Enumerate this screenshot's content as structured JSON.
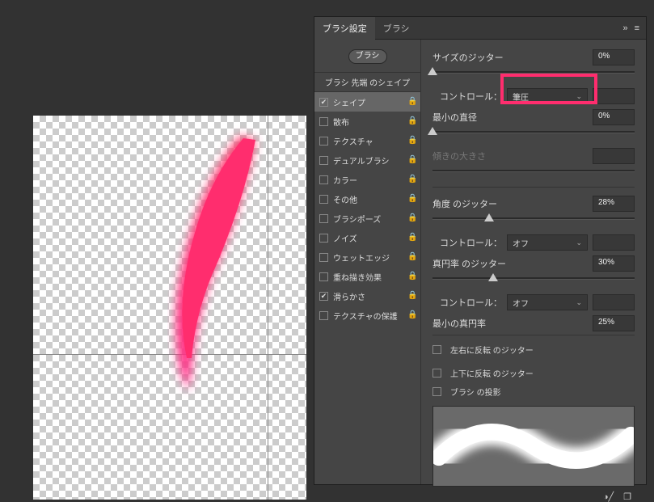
{
  "tabs": {
    "settings": "ブラシ設定",
    "brushes": "ブラシ"
  },
  "presetButton": "ブラシ",
  "tipShapeLabel": "ブラシ 先端 のシェイプ",
  "options": [
    {
      "label": "シェイプ",
      "checked": true,
      "selected": true
    },
    {
      "label": "散布",
      "checked": false
    },
    {
      "label": "テクスチャ",
      "checked": false
    },
    {
      "label": "デュアルブラシ",
      "checked": false
    },
    {
      "label": "カラー",
      "checked": false
    },
    {
      "label": "その他",
      "checked": false
    },
    {
      "label": "ブラシポーズ",
      "checked": false
    },
    {
      "label": "ノイズ",
      "checked": false
    },
    {
      "label": "ウェットエッジ",
      "checked": false
    },
    {
      "label": "重ね描き効果",
      "checked": false
    },
    {
      "label": "滑らかさ",
      "checked": true
    },
    {
      "label": "テクスチャの保護",
      "checked": false
    }
  ],
  "sizeJitter": {
    "label": "サイズのジッター",
    "value": "0%"
  },
  "control1": {
    "label": "コントロール：",
    "value": "筆圧"
  },
  "minDiam": {
    "label": "最小の直径",
    "value": "0%"
  },
  "tiltScale": {
    "label": "傾きの大きさ"
  },
  "angleJitter": {
    "label": "角度 のジッター",
    "value": "28%"
  },
  "control2": {
    "label": "コントロール：",
    "value": "オフ"
  },
  "roundJitter": {
    "label": "真円率 のジッター",
    "value": "30%"
  },
  "control3": {
    "label": "コントロール：",
    "value": "オフ"
  },
  "minRound": {
    "label": "最小の真円率",
    "value": "25%"
  },
  "flipX": "左右に反転 のジッター",
  "flipY": "上下に反転 のジッター",
  "projection": "ブラシ の投影"
}
